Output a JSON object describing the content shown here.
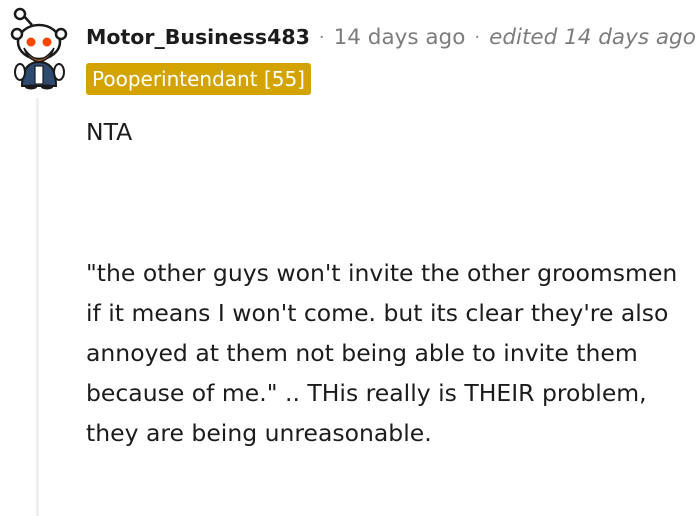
{
  "comment": {
    "username": "Motor_Business483",
    "separator": "·",
    "timestamp": "14 days ago",
    "edited": "edited 14 days ago",
    "flair": "Pooperintendant [55]",
    "paragraphs": [
      "NTA",
      "\"the other guys won't invite the other groomsmen if it means I won't come. but its clear they're also annoyed at them not being able to invite them because of me.\" .. THis really is THEIR problem, they are being unreasonable."
    ]
  },
  "colors": {
    "flair_bg": "#d3a400",
    "meta_text": "#7c7c7c",
    "thread_line": "#edeff1"
  },
  "icons": {
    "avatar": "snoo-avatar-icon"
  }
}
